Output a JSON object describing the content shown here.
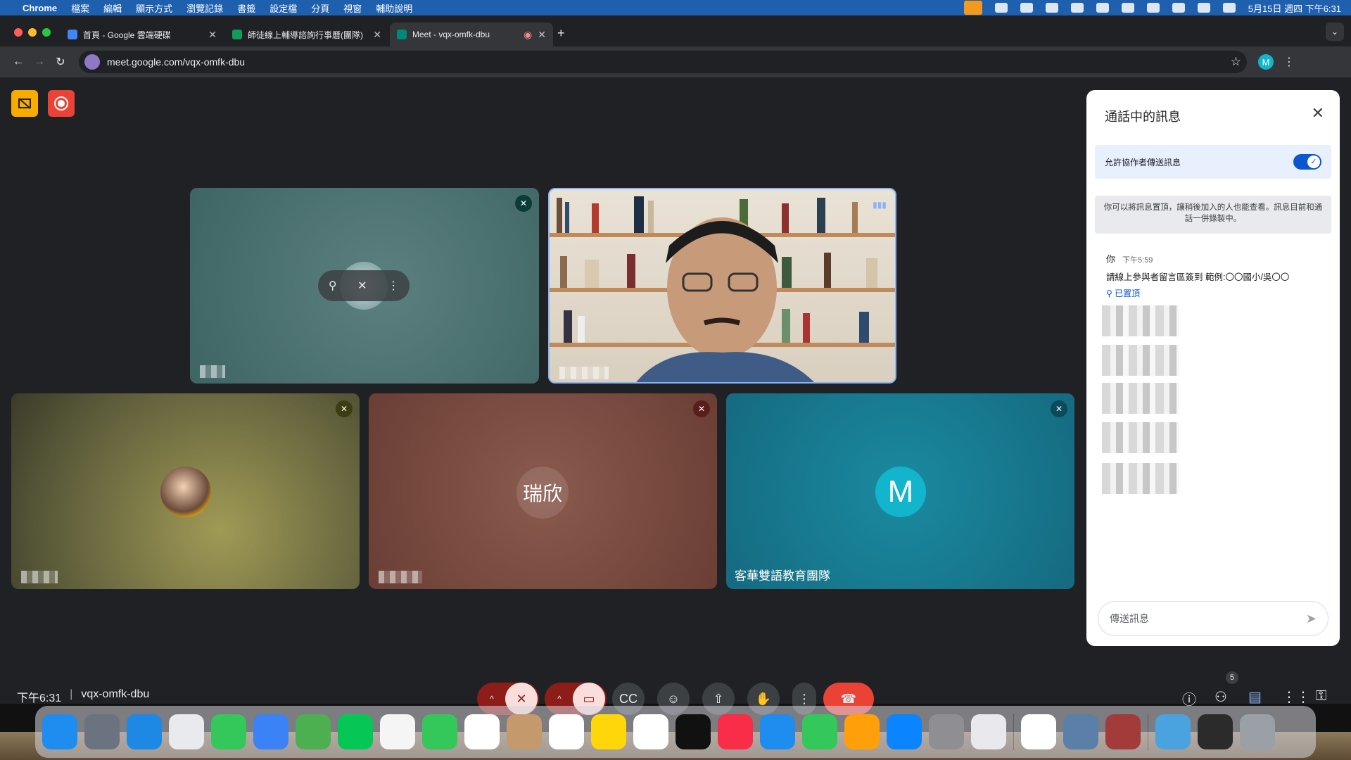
{
  "menubar": {
    "items": [
      "Chrome",
      "檔案",
      "編輯",
      "顯示方式",
      "瀏覽記錄",
      "書籤",
      "設定檔",
      "分頁",
      "視窗",
      "輔助說明"
    ],
    "clock": "5月15日 週四 下午6:31"
  },
  "tabs": [
    {
      "title": "首頁 - Google 雲端硬碟",
      "color": "#4285f4"
    },
    {
      "title": "師徒線上輔導諮詢行事曆(團隊)",
      "color": "#0f9d58"
    },
    {
      "title": "Meet - vqx-omfk-dbu",
      "color": "#00897b"
    }
  ],
  "toolbar": {
    "url": "meet.google.com/vqx-omfk-dbu",
    "profile_initial": "M"
  },
  "stage": {
    "tile_a_name": "",
    "tile_d_initials": "瑞欣",
    "tile_e_initial": "M",
    "tile_e_name": "客華雙語教育團隊"
  },
  "bottom": {
    "time": "下午6:31",
    "meeting_code": "vqx-omfk-dbu",
    "people_count": "5"
  },
  "chat": {
    "title": "通話中的訊息",
    "allow_label": "允許協作者傳送訊息",
    "note": "你可以將訊息置頂，讓稍後加入的人也能查看。訊息目前和通話一併錄製中。",
    "message": {
      "author": "你",
      "time": "下午5:59",
      "body": "請線上參與者留言區簽到 範例:〇〇國小/吳〇〇",
      "pinned_label": "已置頂"
    },
    "input_placeholder": "傳送訊息"
  },
  "colors": {
    "accent": "#0b57d0",
    "end_call": "#ea4335",
    "mic_off": "#f9dedc",
    "menubar": "#1e5fae"
  }
}
